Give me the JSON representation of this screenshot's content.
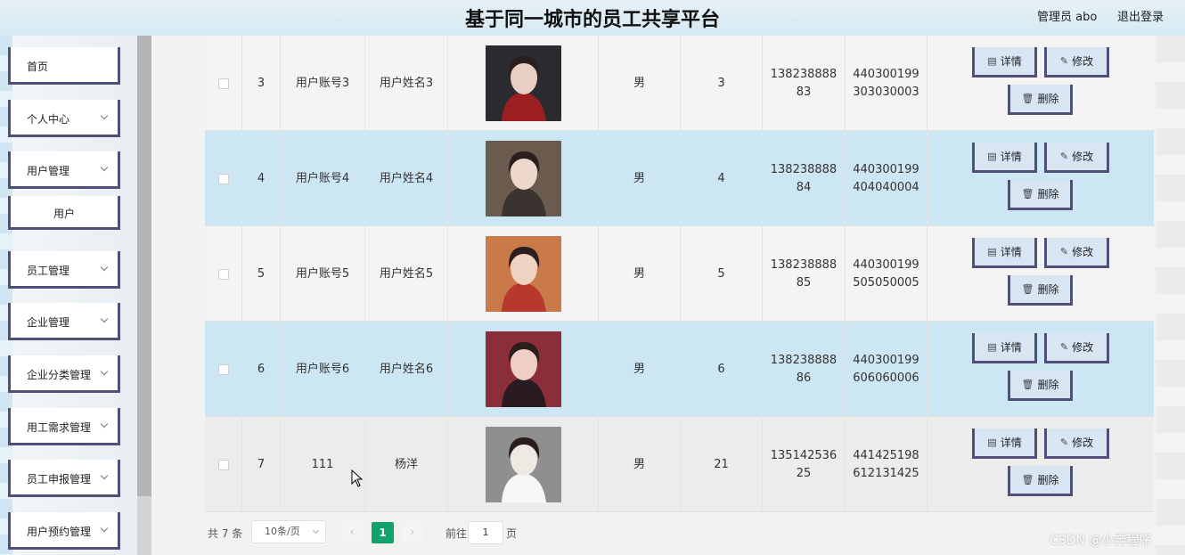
{
  "header": {
    "title": "基于同一城市的员工共享平台",
    "admin": "管理员 abo",
    "logout": "退出登录"
  },
  "sidebar": {
    "items": [
      {
        "label": "首页",
        "expandable": false
      },
      {
        "label": "个人中心",
        "expandable": true
      },
      {
        "label": "用户管理",
        "expandable": true
      },
      {
        "label": "用户",
        "expandable": false,
        "sub": true
      },
      {
        "label": "员工管理",
        "expandable": true
      },
      {
        "label": "企业管理",
        "expandable": true
      },
      {
        "label": "企业分类管理",
        "expandable": true
      },
      {
        "label": "用工需求管理",
        "expandable": true
      },
      {
        "label": "员工申报管理",
        "expandable": true
      },
      {
        "label": "用户预约管理",
        "expandable": true
      }
    ]
  },
  "table": {
    "rows": [
      {
        "id": "3",
        "account": "用户账号3",
        "name": "用户姓名3",
        "gender": "男",
        "age": "3",
        "phone": "13823888883",
        "idcard": "440300199303030003"
      },
      {
        "id": "4",
        "account": "用户账号4",
        "name": "用户姓名4",
        "gender": "男",
        "age": "4",
        "phone": "13823888884",
        "idcard": "440300199404040004"
      },
      {
        "id": "5",
        "account": "用户账号5",
        "name": "用户姓名5",
        "gender": "男",
        "age": "5",
        "phone": "13823888885",
        "idcard": "440300199505050005"
      },
      {
        "id": "6",
        "account": "用户账号6",
        "name": "用户姓名6",
        "gender": "男",
        "age": "6",
        "phone": "13823888886",
        "idcard": "440300199606060006"
      },
      {
        "id": "7",
        "account": "111",
        "name": "杨洋",
        "gender": "男",
        "age": "21",
        "phone": "13514253625",
        "idcard": "441425198612131425"
      }
    ],
    "actions": {
      "detail": "详情",
      "edit": "修改",
      "delete": "删除"
    }
  },
  "pagination": {
    "total": "共 7 条",
    "page_size": "10条/页",
    "current_page": "1",
    "goto_label": "前往",
    "goto_value": "1",
    "goto_unit": "页"
  },
  "watermark": "CSDN @小奔程序",
  "colors": {
    "accent": "#12a36b",
    "button_border": "#4f4f7a",
    "row_highlight": "#cde6f3",
    "button_bg": "#d8e6f4"
  }
}
